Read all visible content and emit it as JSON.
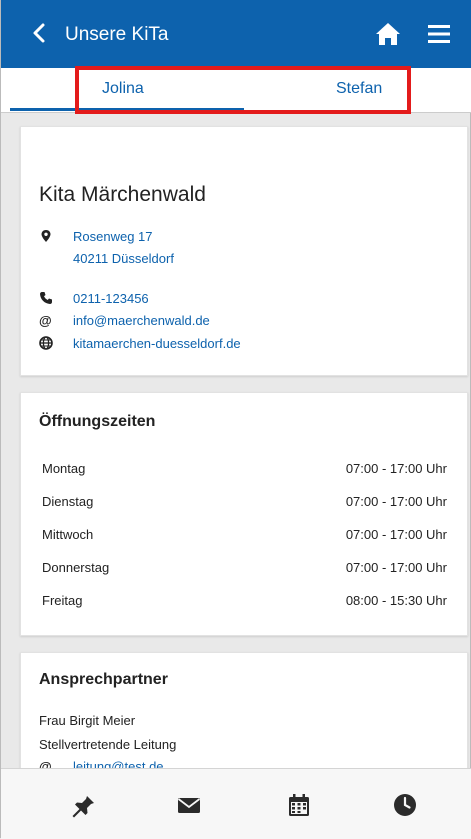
{
  "header": {
    "title": "Unsere KiTa"
  },
  "tabs": [
    {
      "label": "Jolina"
    },
    {
      "label": "Stefan"
    }
  ],
  "kita": {
    "name": "Kita Märchenwald",
    "street": "Rosenweg 17",
    "city": "40211 Düsseldorf",
    "phone": "0211-123456",
    "email": "info@maerchenwald.de",
    "website": "kitamaerchen-duesseldorf.de"
  },
  "hours": {
    "heading": "Öffnungszeiten",
    "rows": [
      {
        "day": "Montag",
        "time": "07:00 - 17:00 Uhr"
      },
      {
        "day": "Dienstag",
        "time": "07:00 - 17:00 Uhr"
      },
      {
        "day": "Mittwoch",
        "time": "07:00 - 17:00 Uhr"
      },
      {
        "day": "Donnerstag",
        "time": "07:00 - 17:00 Uhr"
      },
      {
        "day": "Freitag",
        "time": "08:00 - 15:30 Uhr"
      }
    ]
  },
  "contact": {
    "heading": "Ansprechpartner",
    "name": "Frau Birgit Meier",
    "role": "Stellvertretende Leitung",
    "email": "leitung@test.de"
  },
  "icons": {
    "back": "chevron-left-icon",
    "home": "home-icon",
    "menu": "hamburger-menu-icon",
    "location": "map-marker-icon",
    "phone": "phone-icon",
    "email": "at-icon",
    "web": "globe-icon",
    "nav": [
      "pin-icon",
      "envelope-icon",
      "calendar-icon",
      "clock-icon"
    ]
  },
  "colors": {
    "primary": "#0d62ad",
    "highlight": "#e31b1b"
  }
}
